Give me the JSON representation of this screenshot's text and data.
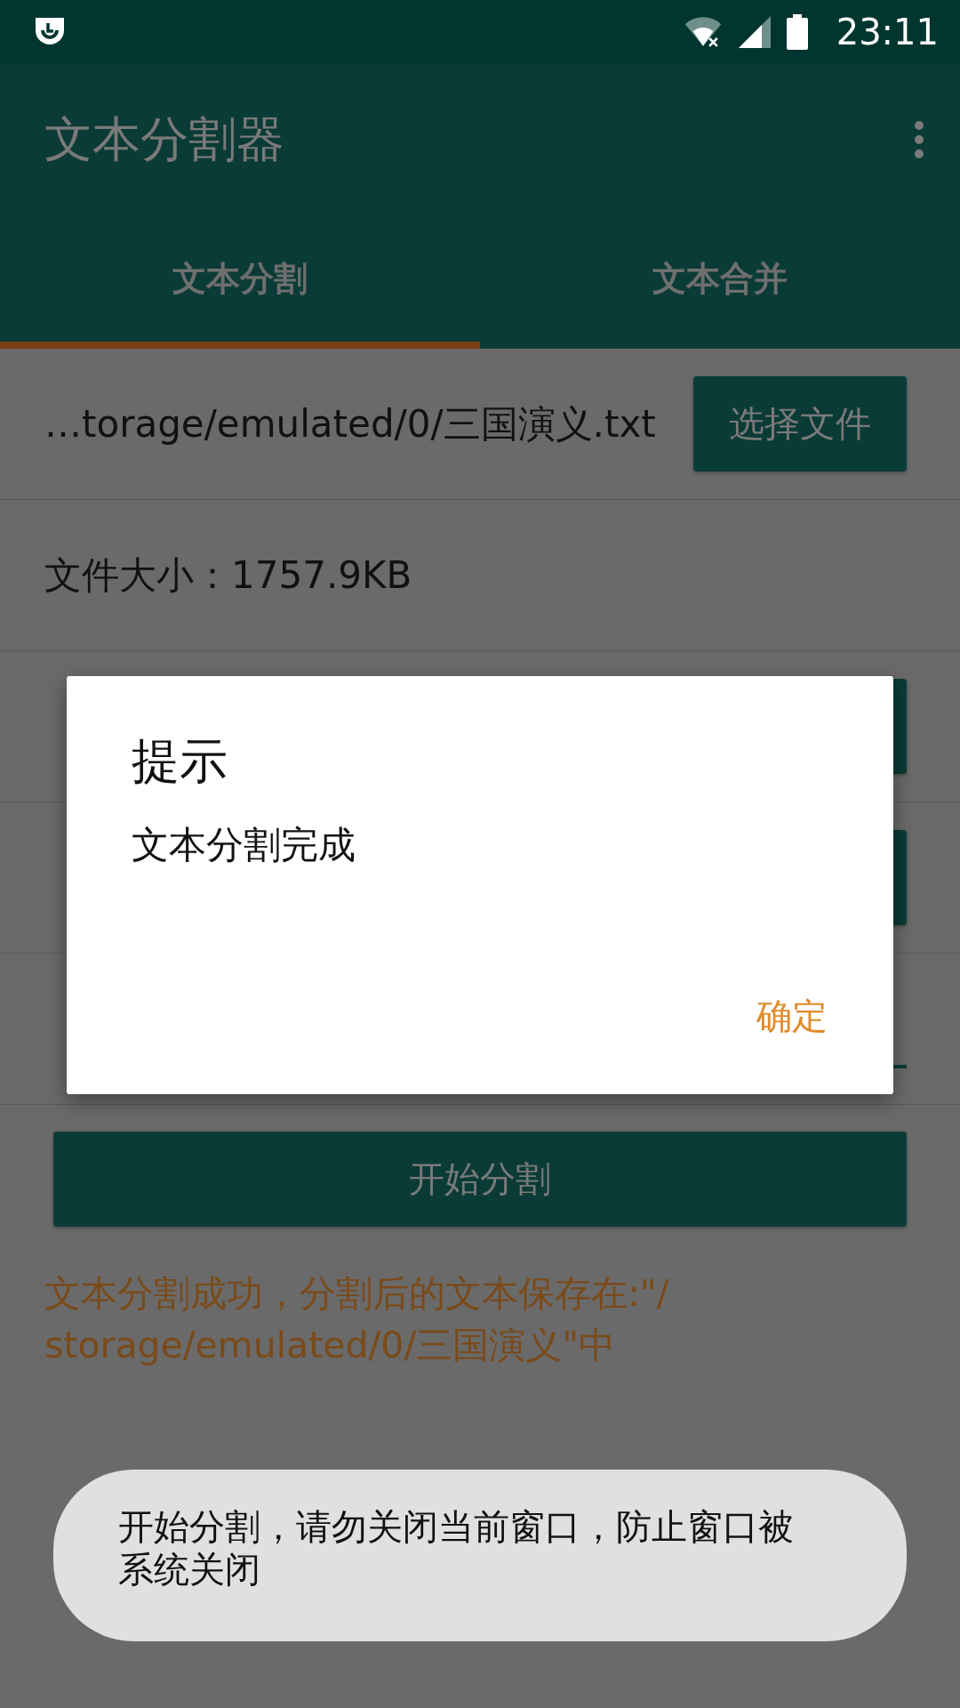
{
  "status_bar": {
    "time": "23:11"
  },
  "app_bar": {
    "title": "文本分割器"
  },
  "tabs": [
    {
      "label": "文本分割",
      "selected": true
    },
    {
      "label": "文本合并",
      "selected": false
    }
  ],
  "rows": [
    {
      "kind": "file",
      "text": "…torage/emulated/0/三国演义.txt",
      "button": "选择文件"
    },
    {
      "kind": "info",
      "text": "文件大小：1757.9KB"
    },
    {
      "kind": "button"
    },
    {
      "kind": "button"
    },
    {
      "kind": "input"
    }
  ],
  "start_button": "开始分割",
  "result": "文本分割成功，分割后的文本保存在:\"/storage/emulated/0/三国演义\"中",
  "dialog": {
    "title": "提示",
    "message": "文本分割完成",
    "ok": "确定"
  },
  "toast": "开始分割，请勿关闭当前窗口，防止窗口被系统关闭"
}
